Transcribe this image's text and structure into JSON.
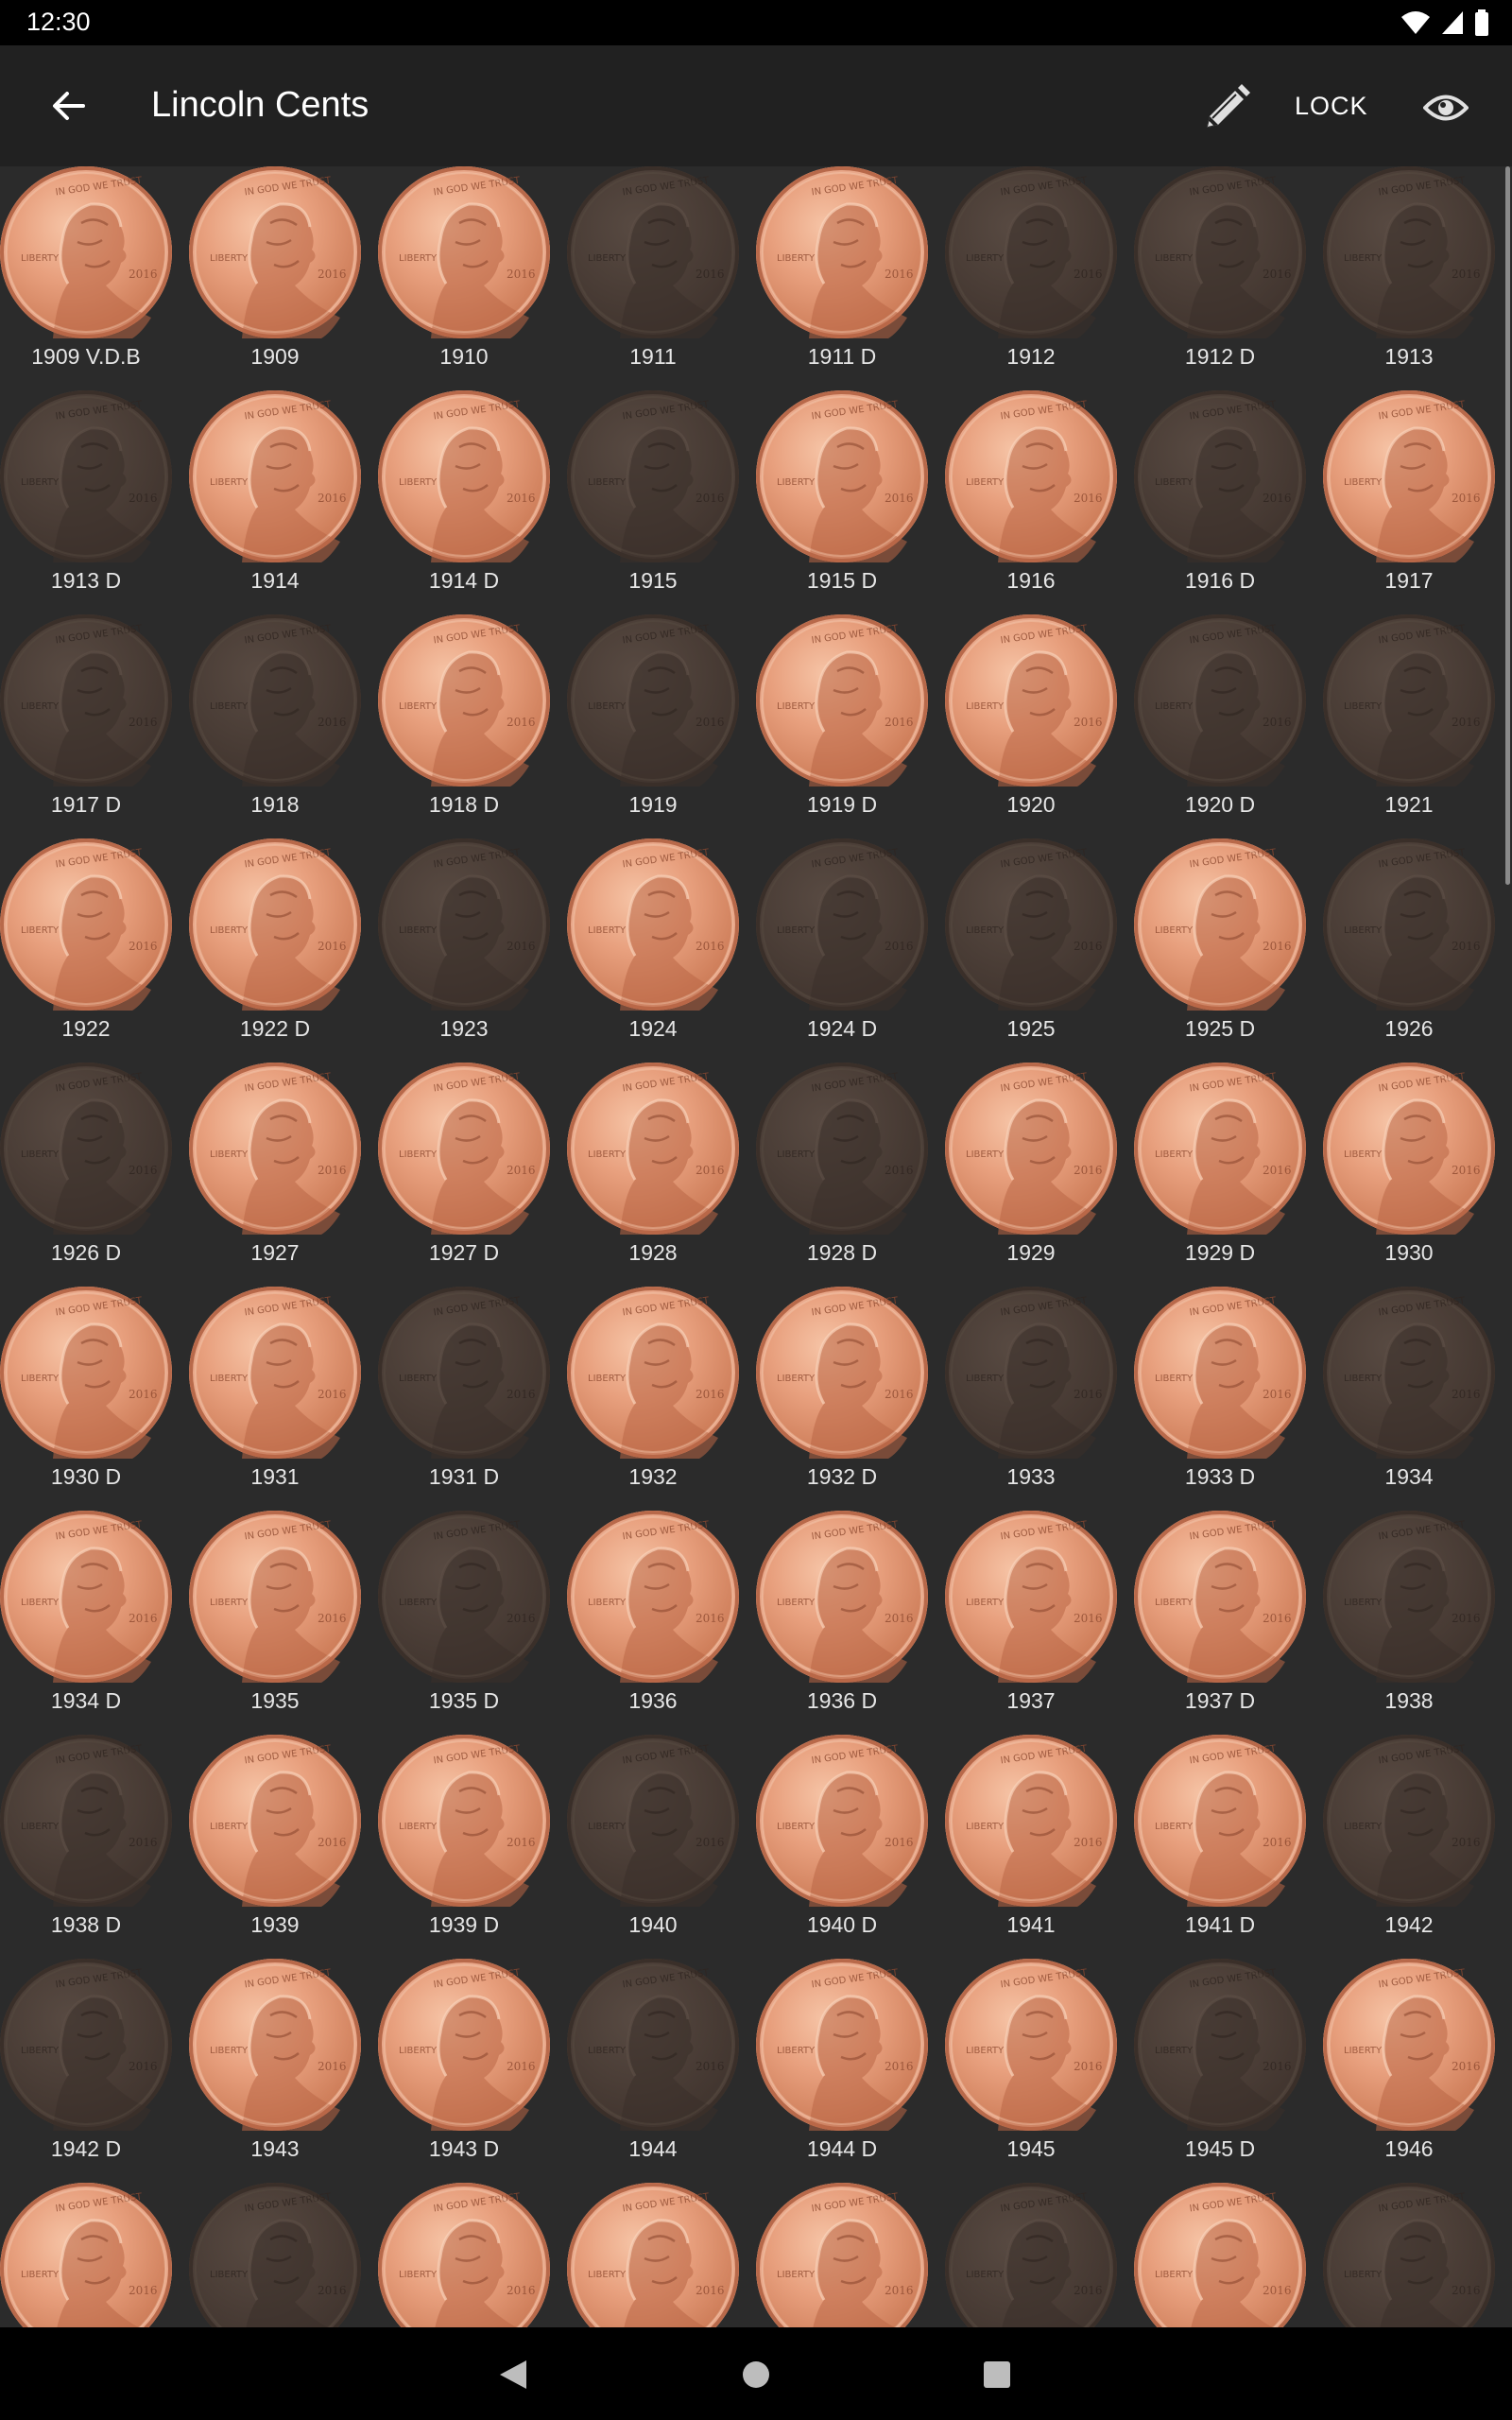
{
  "status_bar": {
    "time": "12:30"
  },
  "app_bar": {
    "title": "Lincoln Cents",
    "back_icon": "arrow-back-icon",
    "edit_icon": "pencil-icon",
    "lock_label": "LOCK",
    "view_icon": "eye-icon"
  },
  "colors": {
    "owned_coin": "#e8a07e",
    "missing_coin": "#4a3d36",
    "background": "#2b2b2b",
    "app_bar": "#212121"
  },
  "coins": [
    {
      "label": "1909 V.D.B",
      "owned": true
    },
    {
      "label": "1909",
      "owned": true
    },
    {
      "label": "1910",
      "owned": true
    },
    {
      "label": "1911",
      "owned": false
    },
    {
      "label": "1911 D",
      "owned": true
    },
    {
      "label": "1912",
      "owned": false
    },
    {
      "label": "1912 D",
      "owned": false
    },
    {
      "label": "1913",
      "owned": false
    },
    {
      "label": "1913 D",
      "owned": false
    },
    {
      "label": "1914",
      "owned": true
    },
    {
      "label": "1914 D",
      "owned": true
    },
    {
      "label": "1915",
      "owned": false
    },
    {
      "label": "1915 D",
      "owned": true
    },
    {
      "label": "1916",
      "owned": true
    },
    {
      "label": "1916 D",
      "owned": false
    },
    {
      "label": "1917",
      "owned": true
    },
    {
      "label": "1917 D",
      "owned": false
    },
    {
      "label": "1918",
      "owned": false
    },
    {
      "label": "1918 D",
      "owned": true
    },
    {
      "label": "1919",
      "owned": false
    },
    {
      "label": "1919 D",
      "owned": true
    },
    {
      "label": "1920",
      "owned": true
    },
    {
      "label": "1920 D",
      "owned": false
    },
    {
      "label": "1921",
      "owned": false
    },
    {
      "label": "1922",
      "owned": true
    },
    {
      "label": "1922 D",
      "owned": true
    },
    {
      "label": "1923",
      "owned": false
    },
    {
      "label": "1924",
      "owned": true
    },
    {
      "label": "1924 D",
      "owned": false
    },
    {
      "label": "1925",
      "owned": false
    },
    {
      "label": "1925 D",
      "owned": true
    },
    {
      "label": "1926",
      "owned": false
    },
    {
      "label": "1926 D",
      "owned": false
    },
    {
      "label": "1927",
      "owned": true
    },
    {
      "label": "1927 D",
      "owned": true
    },
    {
      "label": "1928",
      "owned": true
    },
    {
      "label": "1928 D",
      "owned": false
    },
    {
      "label": "1929",
      "owned": true
    },
    {
      "label": "1929 D",
      "owned": true
    },
    {
      "label": "1930",
      "owned": true
    },
    {
      "label": "1930 D",
      "owned": true
    },
    {
      "label": "1931",
      "owned": true
    },
    {
      "label": "1931 D",
      "owned": false
    },
    {
      "label": "1932",
      "owned": true
    },
    {
      "label": "1932 D",
      "owned": true
    },
    {
      "label": "1933",
      "owned": false
    },
    {
      "label": "1933 D",
      "owned": true
    },
    {
      "label": "1934",
      "owned": false
    },
    {
      "label": "1934 D",
      "owned": true
    },
    {
      "label": "1935",
      "owned": true
    },
    {
      "label": "1935 D",
      "owned": false
    },
    {
      "label": "1936",
      "owned": true
    },
    {
      "label": "1936 D",
      "owned": true
    },
    {
      "label": "1937",
      "owned": true
    },
    {
      "label": "1937 D",
      "owned": true
    },
    {
      "label": "1938",
      "owned": false
    },
    {
      "label": "1938 D",
      "owned": false
    },
    {
      "label": "1939",
      "owned": true
    },
    {
      "label": "1939 D",
      "owned": true
    },
    {
      "label": "1940",
      "owned": false
    },
    {
      "label": "1940 D",
      "owned": true
    },
    {
      "label": "1941",
      "owned": true
    },
    {
      "label": "1941 D",
      "owned": true
    },
    {
      "label": "1942",
      "owned": false
    },
    {
      "label": "1942 D",
      "owned": false
    },
    {
      "label": "1943",
      "owned": true
    },
    {
      "label": "1943 D",
      "owned": true
    },
    {
      "label": "1944",
      "owned": false
    },
    {
      "label": "1944 D",
      "owned": true
    },
    {
      "label": "1945",
      "owned": true
    },
    {
      "label": "1945 D",
      "owned": false
    },
    {
      "label": "1946",
      "owned": true
    },
    {
      "label": "",
      "owned": true
    },
    {
      "label": "",
      "owned": false
    },
    {
      "label": "",
      "owned": true
    },
    {
      "label": "",
      "owned": true
    },
    {
      "label": "",
      "owned": true
    },
    {
      "label": "",
      "owned": false
    },
    {
      "label": "",
      "owned": true
    },
    {
      "label": "",
      "owned": false
    }
  ],
  "nav_bar": {
    "back_icon": "nav-back-triangle-icon",
    "home_icon": "nav-home-circle-icon",
    "recents_icon": "nav-recents-square-icon"
  }
}
